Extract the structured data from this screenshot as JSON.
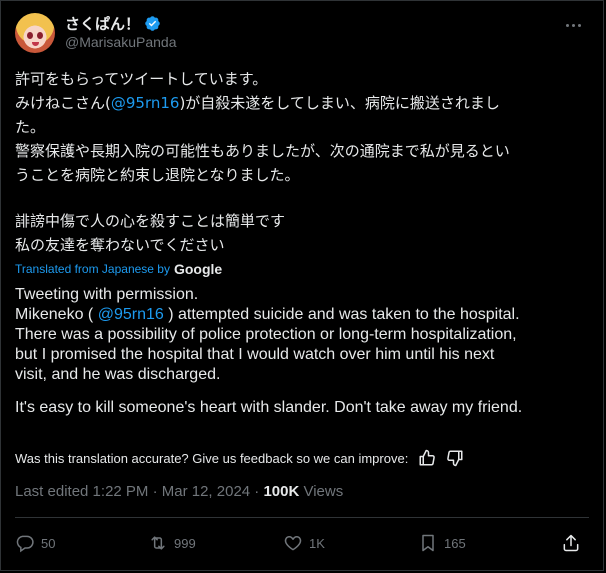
{
  "author": {
    "display_name": "さくぱん！",
    "handle": "@MarisakuPanda"
  },
  "tweet_jp": {
    "line1": "許可をもらってツイートしています。",
    "line2_pre": "みけねこさん(",
    "line2_mention": "@95rn16",
    "line2_post": ")が自殺未遂をしてしまい、病院に搬送されまし",
    "line3": "た。",
    "line4": "警察保護や長期入院の可能性もありましたが、次の通院まで私が見るとい",
    "line5": "うことを病院と約束し退院となりました。",
    "line6": "誹謗中傷で人の心を殺すことは簡単です",
    "line7": "私の友達を奪わないでください"
  },
  "translation": {
    "label": "Translated from Japanese by",
    "provider": "Google",
    "line1": "Tweeting with permission.",
    "line2_pre": "Mikeneko ( ",
    "line2_mention": "@95rn16",
    "line2_post": " ) attempted suicide and was taken to the hospital.",
    "line3": "There was a possibility of police protection or long-term hospitalization,",
    "line4": "but I promised the hospital that I would watch over him until his next",
    "line5": "visit, and he was discharged.",
    "line6": "It's easy to kill someone's heart with slander. Don't take away my friend.",
    "feedback": "Was this translation accurate? Give us feedback so we can improve:"
  },
  "meta": {
    "edited": "Last edited 1:22 PM · Mar 12, 2024 · ",
    "views_count": "100K",
    "views_label": " Views"
  },
  "actions": {
    "replies": "50",
    "reposts": "999",
    "likes": "1K",
    "bookmarks": "165"
  },
  "colors": {
    "accent": "#1d9bf0",
    "muted": "#71767b",
    "background": "#000000"
  }
}
